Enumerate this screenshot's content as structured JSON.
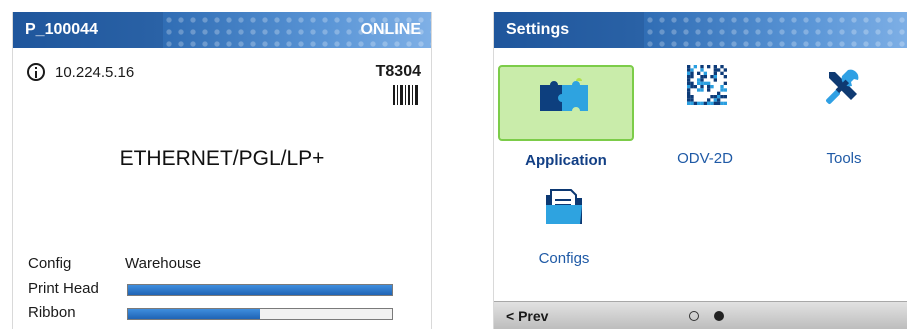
{
  "left_screen": {
    "header": {
      "printer_name": "P_100044",
      "status": "ONLINE"
    },
    "ip_address": "10.224.5.16",
    "model": "T8304",
    "protocol": "ETHERNET/PGL/LP+",
    "config": {
      "label": "Config",
      "value": "Warehouse"
    },
    "print_head": {
      "label": "Print Head",
      "level": 1.0
    },
    "ribbon": {
      "label": "Ribbon",
      "level": 0.5
    },
    "colors": {
      "header": "#2c64a8",
      "bar_fill": "#2a74c9"
    }
  },
  "right_screen": {
    "header": {
      "title": "Settings"
    },
    "tiles": [
      {
        "label": "Application",
        "icon": "puzzle-icon",
        "selected": true
      },
      {
        "label": "ODV-2D",
        "icon": "datamatrix-icon",
        "selected": false
      },
      {
        "label": "Tools",
        "icon": "tools-icon",
        "selected": false
      },
      {
        "label": "Configs",
        "icon": "folder-icon",
        "selected": false
      }
    ],
    "footer": {
      "prev_label": "< Prev",
      "page_current": 2,
      "page_total": 2
    },
    "colors": {
      "selected_tile": "#c9ecaa",
      "selected_border": "#7ccc49",
      "label": "#1f5aa6"
    }
  }
}
